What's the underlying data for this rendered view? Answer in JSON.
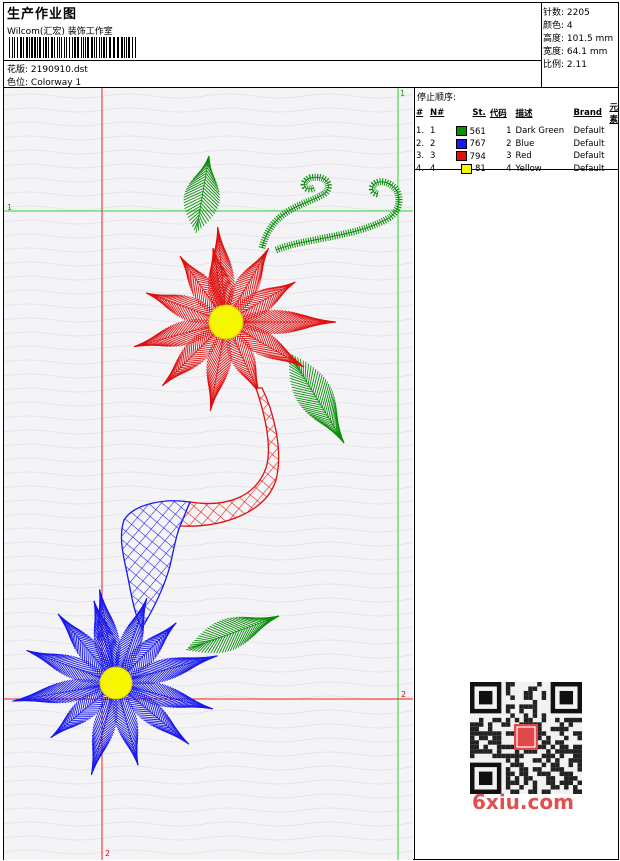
{
  "header": {
    "title": "生产作业图",
    "brand": "Wilcom(汇宏) 装饰工作室",
    "design_label": "花版:",
    "design_value": "2190910.dst",
    "colorway_label": "色位:",
    "colorway_value": "Colorway 1"
  },
  "stats": [
    {
      "label": "针数:",
      "value": "2205"
    },
    {
      "label": "颜色:",
      "value": "4"
    },
    {
      "label": "高度:",
      "value": "101.5 mm"
    },
    {
      "label": "宽度:",
      "value": "64.1 mm"
    },
    {
      "label": "比例:",
      "value": "2.11"
    }
  ],
  "color_table": {
    "title": "停止顺序:",
    "headers": [
      "#",
      "N#",
      "St.",
      "代码",
      "描述",
      "Brand",
      "元素"
    ],
    "rows": [
      {
        "num": "1.",
        "n": "1",
        "st": "561",
        "code": "1",
        "desc": "Dark Green",
        "brand": "Default",
        "color": "#0a8f0a"
      },
      {
        "num": "2.",
        "n": "2",
        "st": "767",
        "code": "2",
        "desc": "Blue",
        "brand": "Default",
        "color": "#1a1aee"
      },
      {
        "num": "3.",
        "n": "3",
        "st": "794",
        "code": "3",
        "desc": "Red",
        "brand": "Default",
        "color": "#e01010"
      },
      {
        "num": "4.",
        "n": "4",
        "st": "81",
        "code": "4",
        "desc": "Yellow",
        "brand": "Default",
        "color": "#f6f600"
      }
    ]
  },
  "guides": {
    "green_label_top": "1",
    "green_label_left": "1",
    "red_label_right": "2",
    "red_label_bottom": "2"
  },
  "watermark": "6xiu.com",
  "colors": {
    "green": "#0a8f0a",
    "blue": "#1a1aee",
    "red": "#e01010",
    "yellow": "#f6f600",
    "guide_green": "#2ad82a",
    "guide_red": "#ee2020"
  }
}
